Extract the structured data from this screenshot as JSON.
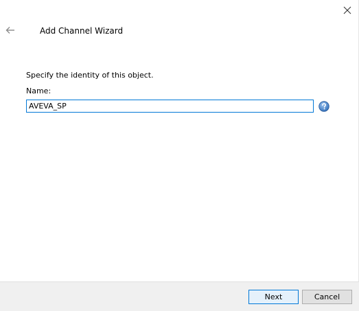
{
  "window": {
    "title": "Add Channel Wizard"
  },
  "icons": {
    "close": "close-icon",
    "back": "back-arrow-icon",
    "help": "help-icon"
  },
  "form": {
    "instruction": "Specify the identity of this object.",
    "name_label": "Name:",
    "name_value": "AVEVA_SP"
  },
  "footer": {
    "next_label": "Next",
    "cancel_label": "Cancel"
  },
  "colors": {
    "accent": "#0078d7",
    "footer_bg": "#f0f0f0",
    "help_icon": "#3b7bc8"
  }
}
